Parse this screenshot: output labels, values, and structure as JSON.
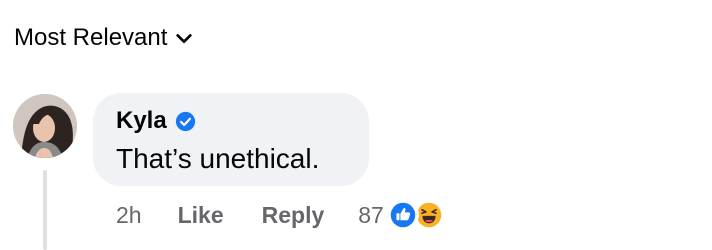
{
  "sort": {
    "label": "Most Relevant"
  },
  "comment": {
    "author": "Kyla",
    "text": "That’s unethical.",
    "time": "2h",
    "like_label": "Like",
    "reply_label": "Reply",
    "reaction_count": "87",
    "reactions": [
      "like-icon",
      "haha-icon"
    ]
  },
  "colors": {
    "bubble": "#f0f2f5",
    "meta_text": "#65676b",
    "verified": "#1877f2",
    "like_reaction": "#1877f2",
    "haha_reaction": "#f7b125"
  }
}
